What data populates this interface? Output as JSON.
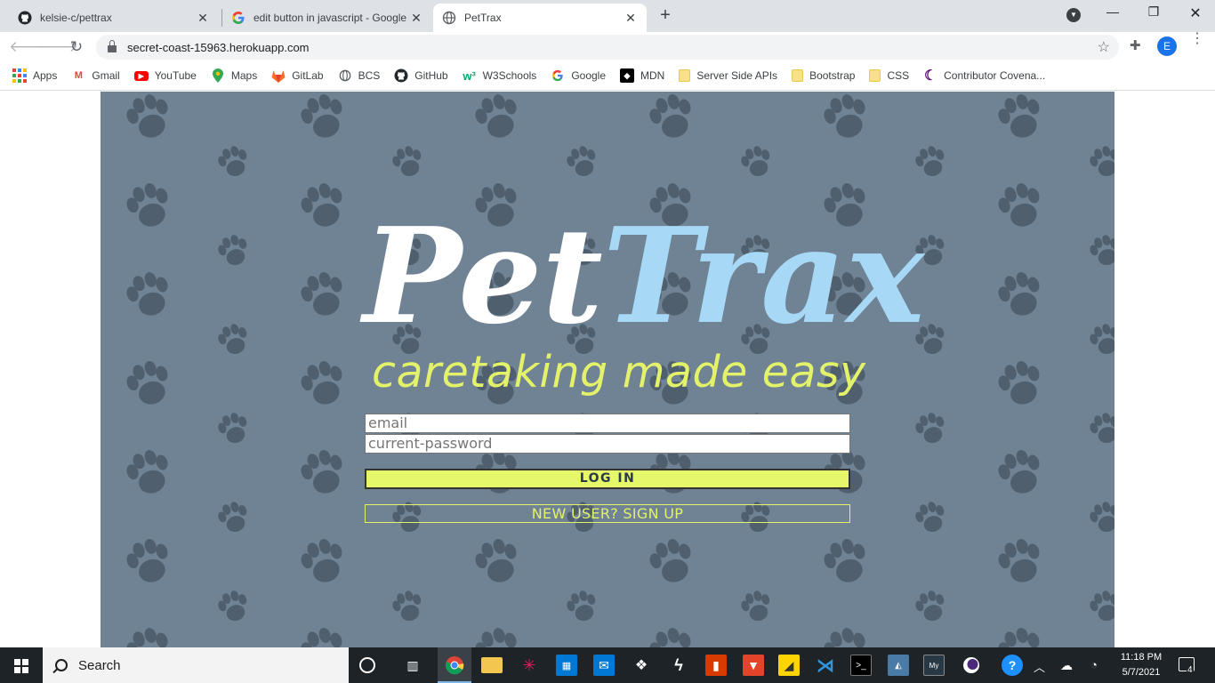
{
  "browser": {
    "tabs": [
      {
        "title": "kelsie-c/pettrax",
        "icon": "github-icon",
        "active": false
      },
      {
        "title": "edit button in javascript - Google",
        "icon": "google-icon",
        "active": false
      },
      {
        "title": "PetTrax",
        "icon": "globe-icon",
        "active": true
      }
    ],
    "url": "secret-coast-15963.herokuapp.com",
    "profile_initial": "E"
  },
  "bookmarks": [
    {
      "label": "Apps",
      "icon": "apps-grid-icon"
    },
    {
      "label": "Gmail",
      "icon": "gmail-icon"
    },
    {
      "label": "YouTube",
      "icon": "youtube-icon"
    },
    {
      "label": "Maps",
      "icon": "maps-pin-icon"
    },
    {
      "label": "GitLab",
      "icon": "gitlab-icon"
    },
    {
      "label": "BCS",
      "icon": "globe-icon"
    },
    {
      "label": "GitHub",
      "icon": "github-icon"
    },
    {
      "label": "W3Schools",
      "icon": "w3schools-icon"
    },
    {
      "label": "Google",
      "icon": "google-icon"
    },
    {
      "label": "MDN",
      "icon": "mdn-icon"
    },
    {
      "label": "Server Side APIs",
      "icon": "folder-icon"
    },
    {
      "label": "Bootstrap",
      "icon": "folder-icon"
    },
    {
      "label": "CSS",
      "icon": "folder-icon"
    },
    {
      "label": "Contributor Covena...",
      "icon": "moon-icon"
    }
  ],
  "page": {
    "logo_part1": "Pet",
    "logo_part2": "Trax",
    "tagline": "caretaking made easy",
    "email_placeholder": "email",
    "password_placeholder": "current-password",
    "login_label": "LOG IN",
    "signup_label": "NEW USER? SIGN UP",
    "colors": {
      "background": "#6f8394",
      "paw": "#4f5f6d",
      "logo_white": "#ffffff",
      "logo_blue": "#a7d9f7",
      "accent_yellow": "#e3f26a"
    }
  },
  "taskbar": {
    "search_label": "Search",
    "time": "11:18 PM",
    "date": "5/7/2021",
    "notification_count": "4",
    "apps": [
      "task-view-icon",
      "chrome-icon",
      "file-explorer-icon",
      "slack-icon",
      "store-icon",
      "mail-icon",
      "dropbox-icon",
      "git-icon",
      "office-icon",
      "gitlab-icon",
      "sticky-notes-icon",
      "vscode-icon",
      "terminal-icon",
      "mysql-workbench-icon",
      "mysql-shell-icon",
      "eclipse-icon",
      "help-icon"
    ]
  }
}
